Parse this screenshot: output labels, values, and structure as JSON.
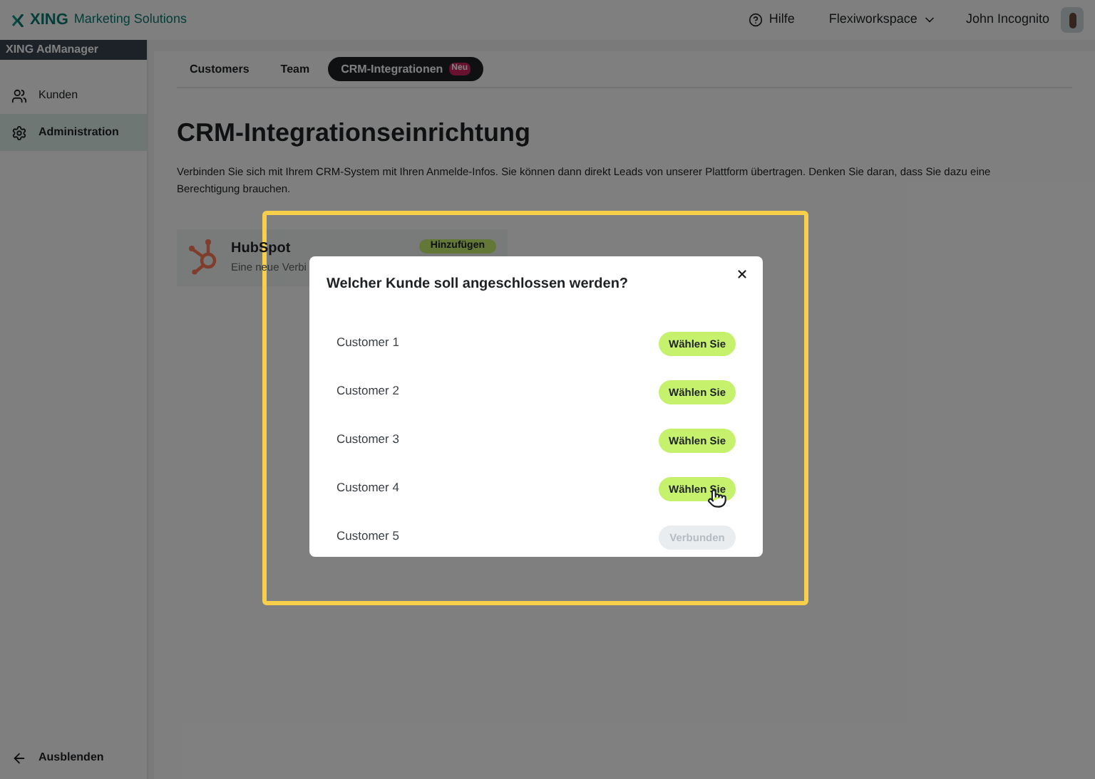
{
  "header": {
    "brand": "XING",
    "brand_sub": "Marketing Solutions",
    "help": "Hilfe",
    "workspace": "Flexiworkspace",
    "user": "John Incognito"
  },
  "sidebar": {
    "title": "XING AdManager",
    "items": [
      {
        "label": "Kunden",
        "selected": false
      },
      {
        "label": "Administration",
        "selected": true
      }
    ],
    "collapse": "Ausblenden"
  },
  "tabs": [
    {
      "label": "Customers",
      "selected": false
    },
    {
      "label": "Team",
      "selected": false
    },
    {
      "label": "CRM-Integrationen",
      "selected": true,
      "badge": "Neu"
    }
  ],
  "page": {
    "title": "CRM-Integrationseinrichtung",
    "description": "Verbinden Sie sich mit Ihrem CRM-System mit Ihren Anmelde-Infos. Sie können dann direkt Leads von unserer Plattform übertragen. Denken Sie daran, dass Sie dazu eine Berechtigung brauchen."
  },
  "integrations": [
    {
      "name": "HubSpot",
      "description": "Eine neue Verbi",
      "button": "Hinzufügen"
    }
  ],
  "dialog": {
    "title": "Welcher Kunde soll angeschlossen werden?",
    "customers": [
      {
        "name": "Customer 1",
        "button": "Wählen Sie",
        "connected": false,
        "hovered": false
      },
      {
        "name": "Customer 2",
        "button": "Wählen Sie",
        "connected": false,
        "hovered": false
      },
      {
        "name": "Customer 3",
        "button": "Wählen Sie",
        "connected": false,
        "hovered": false
      },
      {
        "name": "Customer 4",
        "button": "Wählen Sie",
        "connected": false,
        "hovered": true
      },
      {
        "name": "Customer 5",
        "button": "Verbunden",
        "connected": true,
        "hovered": false
      }
    ]
  }
}
